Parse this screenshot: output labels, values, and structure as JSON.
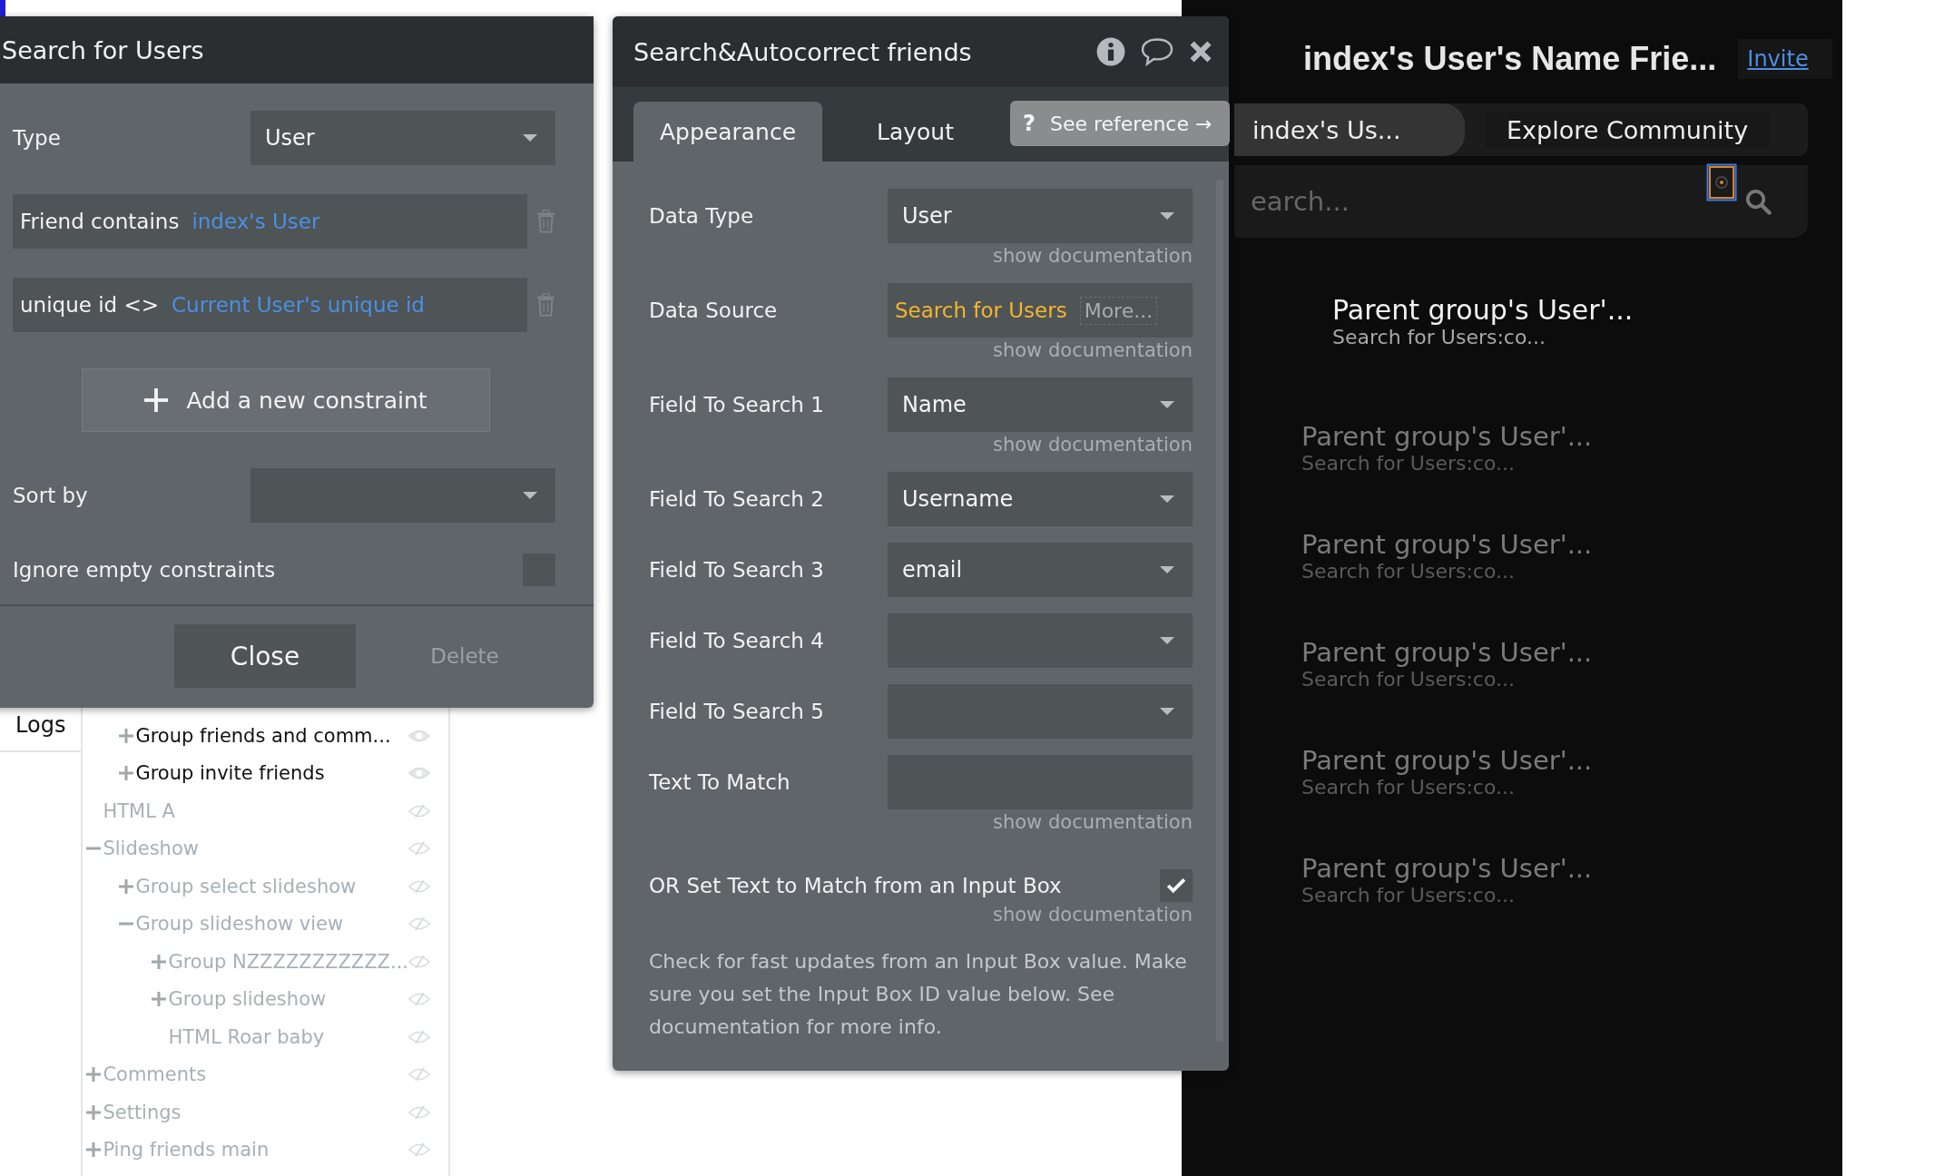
{
  "sidebar": {
    "logs_label": "Logs",
    "tree_cut_parent_children": [
      {
        "label": "Group friends and comm...",
        "expanded": false,
        "hidden": false
      },
      {
        "label": "Group invite friends",
        "expanded": false,
        "hidden": false
      }
    ],
    "tree": [
      {
        "label": "HTML A",
        "hidden": true
      },
      {
        "label": "Slideshow",
        "expanded": true,
        "hidden": true,
        "children": [
          {
            "label": "Group select slideshow",
            "expanded": false,
            "hidden": true
          },
          {
            "label": "Group slideshow view",
            "expanded": true,
            "hidden": true,
            "children": [
              {
                "label": "Group NZZZZZZZZZZZ...",
                "expanded": false,
                "hidden": true
              },
              {
                "label": "Group slideshow",
                "expanded": false,
                "hidden": true
              },
              {
                "label": "HTML Roar baby",
                "hidden": true
              }
            ]
          }
        ]
      },
      {
        "label": "Comments",
        "expanded": false,
        "hidden": true
      },
      {
        "label": "Settings",
        "expanded": false,
        "hidden": true
      },
      {
        "label": "Ping friends main",
        "expanded": false,
        "hidden": true
      }
    ]
  },
  "search_panel": {
    "title": "Search for Users",
    "type_label": "Type",
    "type_value": "User",
    "constraints": [
      {
        "key": "Friend contains",
        "value": "index's User"
      },
      {
        "key": "unique id <>",
        "value": "Current User's unique id"
      }
    ],
    "add_constraint": "Add a new constraint",
    "sort_label": "Sort by",
    "ignore_label": "Ignore empty constraints",
    "ignore_checked": false,
    "buttons": [
      {
        "label": "Close",
        "disabled": false
      },
      {
        "label": "Delete",
        "disabled": true
      }
    ]
  },
  "property_panel": {
    "title": "Search&Autocorrect friends",
    "tabs": [
      {
        "label": "Appearance",
        "selected": true
      },
      {
        "label": "Layout",
        "selected": false
      }
    ],
    "reference_button": "See reference →",
    "reference_icon": "?",
    "rows": [
      {
        "kind": "dropdown",
        "label": "Data Type",
        "value": "User",
        "documentation": "show documentation"
      },
      {
        "kind": "expression",
        "label": "Data Source",
        "value": "Search for Users",
        "more": "More...",
        "documentation": "show documentation"
      },
      {
        "kind": "dropdown",
        "label": "Field To Search 1",
        "value": "Name",
        "documentation": "show documentation"
      },
      {
        "kind": "dropdown",
        "label": "Field To Search 2",
        "value": "Username"
      },
      {
        "kind": "dropdown",
        "label": "Field To Search 3",
        "value": "email"
      },
      {
        "kind": "dropdown",
        "label": "Field To Search 4"
      },
      {
        "kind": "dropdown",
        "label": "Field To Search 5"
      },
      {
        "kind": "text",
        "label": "Text To Match",
        "documentation": "show documentation"
      },
      {
        "kind": "checkbox",
        "label": "OR Set Text to Match from an Input Box",
        "checked": true,
        "documentation": "show documentation"
      }
    ],
    "note": "Check for fast updates from an Input Box value. Make sure you set the Input Box ID value below. See documentation for more info."
  },
  "preview": {
    "title": "index's User's Name Frie...",
    "invite_link": "Invite",
    "tabs": [
      {
        "label": "index's Us...",
        "selected": true
      },
      {
        "label": "Explore Community",
        "selected": false
      }
    ],
    "search_placeholder": "earch...",
    "results": [
      {
        "title": "Parent group's User'...",
        "subtitle": "Search for Users:co...",
        "dimmed": false
      },
      {
        "title": "Parent group's User'...",
        "subtitle": "Search for Users:co...",
        "dimmed": true
      },
      {
        "title": "Parent group's User'...",
        "subtitle": "Search for Users:co...",
        "dimmed": true
      },
      {
        "title": "Parent group's User'...",
        "subtitle": "Search for Users:co...",
        "dimmed": true
      },
      {
        "title": "Parent group's User'...",
        "subtitle": "Search for Users:co...",
        "dimmed": true
      },
      {
        "title": "Parent group's User'...",
        "subtitle": "Search for Users:co...",
        "dimmed": true
      }
    ]
  }
}
